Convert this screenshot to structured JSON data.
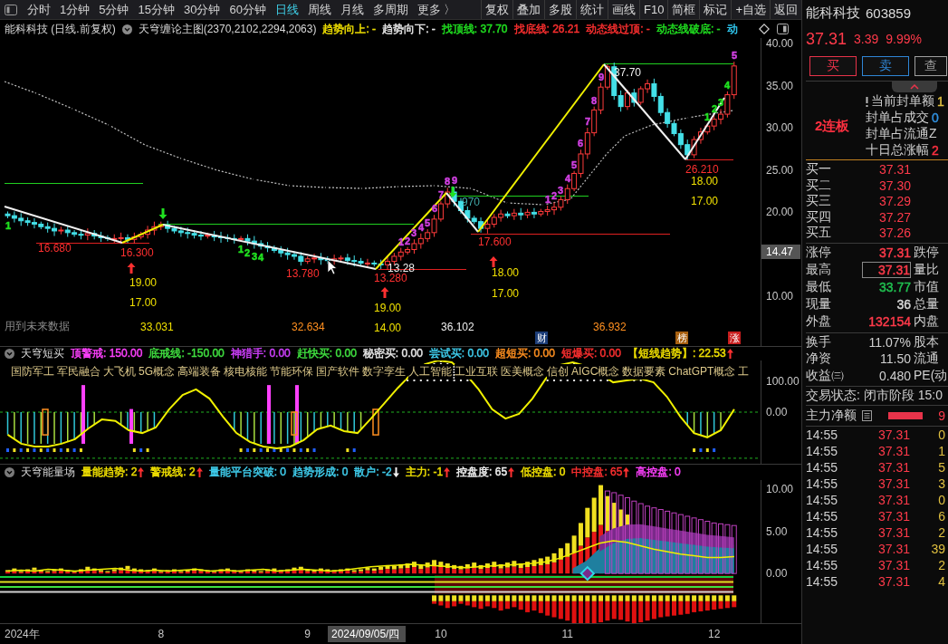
{
  "toolbar": {
    "periods": [
      {
        "label": "分时",
        "selected": false
      },
      {
        "label": "1分钟",
        "selected": false
      },
      {
        "label": "5分钟",
        "selected": false
      },
      {
        "label": "15分钟",
        "selected": false
      },
      {
        "label": "30分钟",
        "selected": false
      },
      {
        "label": "60分钟",
        "selected": false
      },
      {
        "label": "日线",
        "selected": true
      },
      {
        "label": "周线",
        "selected": false
      },
      {
        "label": "月线",
        "selected": false
      },
      {
        "label": "多周期",
        "selected": false
      },
      {
        "label": "更多 〉",
        "selected": false
      }
    ],
    "actions": [
      "复权",
      "叠加",
      "多股",
      "统计",
      "画线",
      "F10",
      "简框",
      "标记",
      "+自选",
      "返回"
    ]
  },
  "main_chart": {
    "title": "能科科技 (日线.前复权)",
    "indicator": "天穹缠论主图(2370,2102,2294,2063)",
    "fields": [
      {
        "text": "趋势向上: -",
        "color": "#f0e000"
      },
      {
        "text": "趋势向下: -",
        "color": "#e8e8e8"
      },
      {
        "text": "找顶线: 37.70",
        "color": "#20e020"
      },
      {
        "text": "找底线: 26.21",
        "color": "#ff3030"
      },
      {
        "text": "动态线过顶: -",
        "color": "#ff3030"
      },
      {
        "text": "动态线破底: -",
        "color": "#20e020"
      },
      {
        "text": "动",
        "color": "#30c8f0"
      }
    ],
    "price_axis": [
      "40.00",
      "35.00",
      "30.00",
      "25.00",
      "20.00",
      "10.00"
    ],
    "crosshair_price": "14.47",
    "labels": [
      {
        "text": "用到未来数据",
        "color": "#8a8a8a"
      },
      {
        "text": "16.680",
        "color": "#ff3030"
      },
      {
        "text": "16.300",
        "color": "#ff3030"
      },
      {
        "text": "19.00",
        "color": "#f0e000"
      },
      {
        "text": "17.00",
        "color": "#f0e000"
      },
      {
        "text": "33.031",
        "color": "#f0e000"
      },
      {
        "text": "13.780",
        "color": "#ff3030"
      },
      {
        "text": "32.634",
        "color": "#ff9020"
      },
      {
        "text": "13.280",
        "color": "#ff3030"
      },
      {
        "text": "13.28",
        "color": "#f0f0f0"
      },
      {
        "text": "19.00",
        "color": "#f0e000"
      },
      {
        "text": "14.00",
        "color": "#f0e000"
      },
      {
        "text": "36.102",
        "color": "#f0f0f0"
      },
      {
        "text": "970",
        "color": "#40a8a8"
      },
      {
        "text": "17.600",
        "color": "#ff3030"
      },
      {
        "text": "18.00",
        "color": "#f0e000"
      },
      {
        "text": "17.00",
        "color": "#f0e000"
      },
      {
        "text": "36.932",
        "color": "#ff9020"
      },
      {
        "text": "37.70",
        "color": "#f0f0f0"
      },
      {
        "text": "26.210",
        "color": "#ff3030"
      },
      {
        "text": "18.00",
        "color": "#f0e000"
      },
      {
        "text": "17.00",
        "color": "#f0e000"
      }
    ],
    "counts": [
      {
        "text": "1",
        "color": "#20e020"
      },
      {
        "text": "1",
        "color": "#20e020"
      },
      {
        "text": "2",
        "color": "#20e020"
      },
      {
        "text": "3",
        "color": "#20e020"
      },
      {
        "text": "4",
        "color": "#20e020"
      },
      {
        "text": "1",
        "color": "#d040e0"
      },
      {
        "text": "2",
        "color": "#d040e0"
      },
      {
        "text": "3",
        "color": "#d040e0"
      },
      {
        "text": "4",
        "color": "#d040e0"
      },
      {
        "text": "5",
        "color": "#d040e0"
      },
      {
        "text": "6",
        "color": "#d040e0"
      },
      {
        "text": "7",
        "color": "#d040e0"
      },
      {
        "text": "8",
        "color": "#d040e0"
      },
      {
        "text": "9",
        "color": "#d040e0"
      },
      {
        "text": "1",
        "color": "#d040e0"
      },
      {
        "text": "2",
        "color": "#d040e0"
      },
      {
        "text": "3",
        "color": "#d040e0"
      },
      {
        "text": "4",
        "color": "#d040e0"
      },
      {
        "text": "5",
        "color": "#d040e0"
      },
      {
        "text": "6",
        "color": "#d040e0"
      },
      {
        "text": "7",
        "color": "#d040e0"
      },
      {
        "text": "8",
        "color": "#d040e0"
      },
      {
        "text": "9",
        "color": "#d040e0"
      },
      {
        "text": "1",
        "color": "#20e020"
      },
      {
        "text": "2",
        "color": "#20e020"
      },
      {
        "text": "3",
        "color": "#20e020"
      },
      {
        "text": "4",
        "color": "#20e020"
      },
      {
        "text": "5",
        "color": "#d040e0"
      }
    ],
    "tags": [
      {
        "text": "财",
        "color": "#1c3d78"
      },
      {
        "text": "榜",
        "color": "#a86010"
      },
      {
        "text": "涨",
        "color": "#c81e1e"
      }
    ]
  },
  "short_buy": {
    "title": "天穹短买",
    "fields": [
      {
        "label": "顶警戒: 150.00",
        "color": "#ff40ff"
      },
      {
        "label": "底戒线: -150.00",
        "color": "#40e040"
      },
      {
        "label": "神猎手: 0.00",
        "color": "#d040ff"
      },
      {
        "label": "赶快买: 0.00",
        "color": "#40e040"
      },
      {
        "label": "秘密买: 0.00",
        "color": "#e8e8e8"
      },
      {
        "label": "尝试买: 0.00",
        "color": "#40d0f0"
      },
      {
        "label": "超短买: 0.00",
        "color": "#ff9020"
      },
      {
        "label": "短爆买: 0.00",
        "color": "#ff3030"
      },
      {
        "label": "【短线趋势】: 22.53",
        "color": "#f0e000",
        "arrow": {
          "kind": "up",
          "color": "#ff3030"
        }
      }
    ],
    "concepts": [
      "国防军工",
      "军民融合",
      "大飞机",
      "5G概念",
      "高端装备",
      "核电核能",
      "节能环保",
      "国产软件",
      "数字孪生",
      "人工智能",
      "工业互联",
      "医美概念",
      "信创",
      "AIGC概念",
      "数据要素",
      "ChatGPT概念",
      "工"
    ],
    "axis": [
      "100.00",
      "0.00"
    ]
  },
  "energy_field": {
    "title": "天穹能量场",
    "fields": [
      {
        "label": "量能趋势: 2",
        "color": "#f0e000",
        "arrow": {
          "kind": "up",
          "color": "#ff3030"
        }
      },
      {
        "label": "警戒线: 2",
        "color": "#f0e000",
        "arrow": {
          "kind": "up",
          "color": "#ff3030"
        }
      },
      {
        "label": "量能平台突破: 0",
        "color": "#40d0f0"
      },
      {
        "label": "趋势形成: 0",
        "color": "#40d0f0"
      },
      {
        "label": "散户: -2",
        "color": "#40d0f0",
        "arrow": {
          "kind": "down",
          "color": "#f0f0f0"
        }
      },
      {
        "label": "主力: -1",
        "color": "#f0e000",
        "arrow": {
          "kind": "up",
          "color": "#ff3030"
        }
      },
      {
        "label": "控盘度: 65",
        "color": "#f0f0f0",
        "arrow": {
          "kind": "up",
          "color": "#ff3030"
        }
      },
      {
        "label": "低控盘: 0",
        "color": "#f0e000"
      },
      {
        "label": "中控盘: 65",
        "color": "#ff3030",
        "arrow": {
          "kind": "up",
          "color": "#ff3030"
        }
      },
      {
        "label": "高控盘: 0",
        "color": "#ff40ff"
      }
    ],
    "axis": [
      "10.00",
      "5.00",
      "0.00"
    ]
  },
  "date_axis": {
    "year": "2024年",
    "months": [
      "8",
      "9",
      "10",
      "11",
      "12"
    ],
    "cursor": "2024/09/05/四"
  },
  "quote_panel": {
    "name": "能科科技",
    "code": "603859",
    "price": "37.31",
    "change": "3.39",
    "change_pct": "9.99%",
    "buttons": [
      {
        "label": "买",
        "color": "#e8334a"
      },
      {
        "label": "卖",
        "color": "#2f86d6"
      },
      {
        "label": "查",
        "color": "#a0a0a0"
      }
    ],
    "streak": "2连板",
    "seal_info": [
      {
        "label": "当前封单额",
        "value": "1",
        "color": "#e0c040"
      },
      {
        "label": "封单占成交",
        "value": "0",
        "color": "#3090e0"
      },
      {
        "label": "封单占流通Z"
      },
      {
        "label": "十日总涨幅",
        "value": "2",
        "color": "#ff3040"
      }
    ],
    "bids": [
      {
        "label": "买一",
        "price": "37.31"
      },
      {
        "label": "买二",
        "price": "37.30"
      },
      {
        "label": "买三",
        "price": "37.29"
      },
      {
        "label": "买四",
        "price": "37.27"
      },
      {
        "label": "买五",
        "price": "37.26"
      }
    ],
    "stats": [
      {
        "label": "涨停",
        "value": "37.31",
        "color": "#ff3a4a",
        "label2": "跌停",
        "boxed": false
      },
      {
        "label": "最高",
        "value": "37.31",
        "color": "#ff3a4a",
        "label2": "量比",
        "boxed": true
      },
      {
        "label": "最低",
        "value": "33.77",
        "color": "#20c050",
        "label2": "市值",
        "boxed": false
      },
      {
        "label": "现量",
        "value": "36",
        "color": "#d8d8d8",
        "label2": "总量",
        "boxed": false
      },
      {
        "label": "外盘",
        "value": "132154",
        "color": "#ff3a4a",
        "label2": "内盘",
        "boxed": false
      }
    ],
    "stats2": [
      {
        "label": "换手",
        "value": "11.07%",
        "label2": "股本"
      },
      {
        "label": "净资",
        "value": "11.50",
        "label2": "流通"
      },
      {
        "label": "收益㈢",
        "value": "0.480",
        "label2": "PE(动"
      }
    ],
    "trade_status": "交易状态: 闭市阶段 15:0",
    "flow": {
      "label": "主力净额",
      "value": "9"
    },
    "ticks": [
      {
        "time": "14:55",
        "price": "37.31",
        "volume": "0"
      },
      {
        "time": "14:55",
        "price": "37.31",
        "volume": "1"
      },
      {
        "time": "14:55",
        "price": "37.31",
        "volume": "5"
      },
      {
        "time": "14:55",
        "price": "37.31",
        "volume": "3"
      },
      {
        "time": "14:55",
        "price": "37.31",
        "volume": "0"
      },
      {
        "time": "14:55",
        "price": "37.31",
        "volume": "6"
      },
      {
        "time": "14:55",
        "price": "37.31",
        "volume": "2"
      },
      {
        "time": "14:55",
        "price": "37.31",
        "volume": "39"
      },
      {
        "time": "14:55",
        "price": "37.31",
        "volume": "2"
      },
      {
        "time": "14:55",
        "price": "37.31",
        "volume": "4"
      }
    ]
  }
}
